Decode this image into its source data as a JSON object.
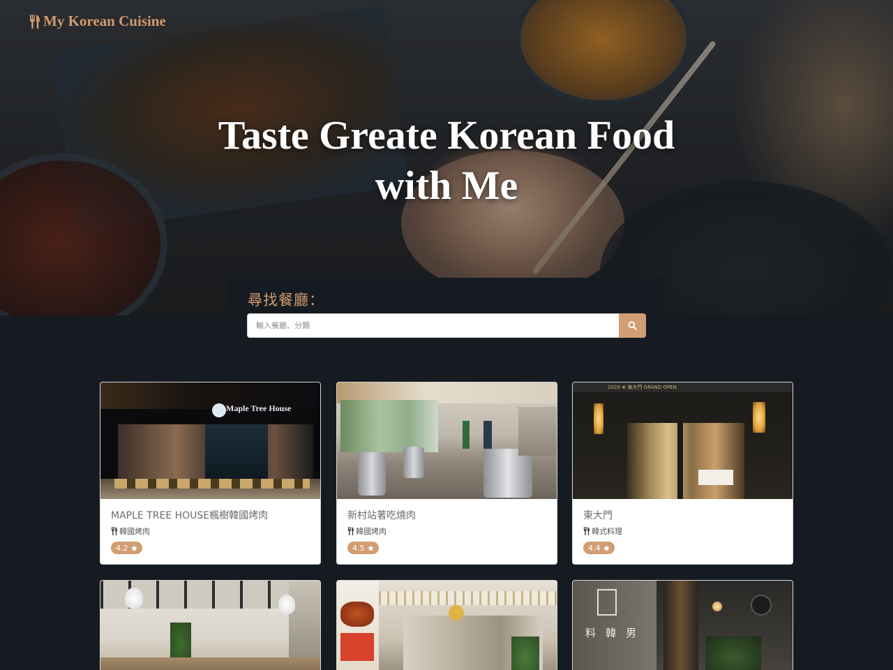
{
  "brand": {
    "name": "My Korean Cuisine",
    "icon": "utensils-icon",
    "color": "#d39b6e"
  },
  "hero": {
    "title_line1": "Taste Greate Korean Food",
    "title_line2": "with Me"
  },
  "search": {
    "label": "尋找餐廳：",
    "placeholder": "輸入餐廳、分類",
    "button_icon": "search-icon"
  },
  "restaurants": [
    {
      "name": "MAPLE TREE HOUSE楓樹韓國烤肉",
      "category": "韓國烤肉",
      "rating": "4.2"
    },
    {
      "name": "新村站著吃燒肉",
      "category": "韓國烤肉",
      "rating": "4.5"
    },
    {
      "name": "東大門",
      "category": "韓式料理",
      "rating": "4.4"
    },
    {
      "name": "",
      "category": "",
      "rating": ""
    },
    {
      "name": "",
      "category": "",
      "rating": ""
    },
    {
      "name": "",
      "category": "",
      "rating": ""
    }
  ],
  "photo_signs": {
    "maple": "Maple Tree House",
    "dongdaemun_top": "2020 ★ 東大門 GRAND OPEN",
    "chef_chars": [
      "料",
      "韓",
      "男"
    ]
  },
  "colors": {
    "accent": "#d19d72",
    "page_bg": "#161b22"
  }
}
